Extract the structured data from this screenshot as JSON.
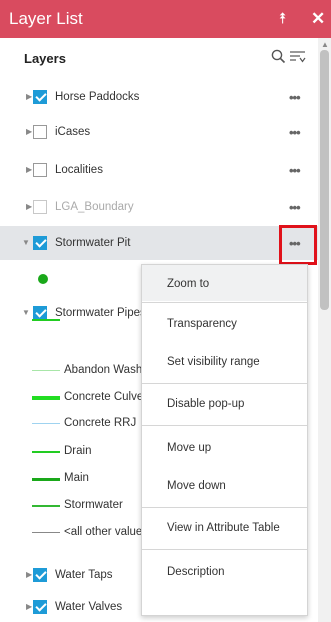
{
  "window": {
    "title": "Layer List"
  },
  "header": {
    "layers_label": "Layers"
  },
  "layers": [
    {
      "name": "Horse Paddocks",
      "checked": true
    },
    {
      "name": "iCases",
      "checked": false
    },
    {
      "name": "Localities",
      "checked": false
    },
    {
      "name": "LGA_Boundary",
      "checked": false
    },
    {
      "name": "Stormwater Pit",
      "checked": true
    },
    {
      "name": "Stormwater Pipes",
      "checked": true
    },
    {
      "name": "Water Taps",
      "checked": true
    },
    {
      "name": "Water Valves",
      "checked": true
    }
  ],
  "pipe_legend": [
    {
      "name": "Abandon Wash",
      "color": "#a8e6a8"
    },
    {
      "name": "Concrete Culve",
      "color": "#22dd22"
    },
    {
      "name": "Concrete RRJ",
      "color": "#9fd3f0"
    },
    {
      "name": "Drain",
      "color": "#22cc22"
    },
    {
      "name": "Main",
      "color": "#1aa81a"
    },
    {
      "name": "Stormwater",
      "color": "#33b833"
    },
    {
      "name": "<all other value",
      "color": "#888888"
    }
  ],
  "context_menu": [
    "Zoom to",
    "Transparency",
    "Set visibility range",
    "Disable pop-up",
    "Move up",
    "Move down",
    "View in Attribute Table",
    "Description"
  ],
  "icons": {
    "more": "•••",
    "collapse": "chevrons-up-icon",
    "close": "close-icon"
  },
  "colors": {
    "accent": "#d94b5f",
    "checkbox": "#1e9bd7",
    "highlight": "#e0111a"
  }
}
